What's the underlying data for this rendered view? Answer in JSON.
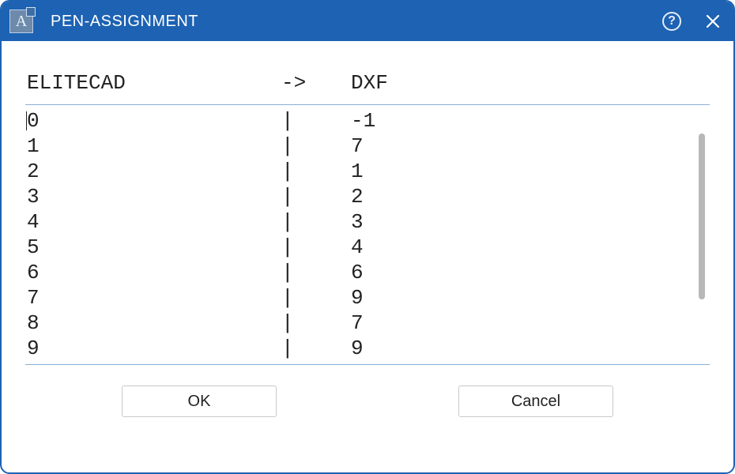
{
  "titlebar": {
    "app_icon_letter": "A",
    "title": "PEN-ASSIGNMENT",
    "help_label": "?",
    "close_label": "×"
  },
  "headers": {
    "left": "ELITECAD",
    "arrow": "->",
    "right": "DXF"
  },
  "separator": "|",
  "rows": [
    {
      "left": "0",
      "right": "-1"
    },
    {
      "left": "1",
      "right": "7"
    },
    {
      "left": "2",
      "right": "1"
    },
    {
      "left": "3",
      "right": "2"
    },
    {
      "left": "4",
      "right": "3"
    },
    {
      "left": "5",
      "right": "4"
    },
    {
      "left": "6",
      "right": "6"
    },
    {
      "left": "7",
      "right": "9"
    },
    {
      "left": "8",
      "right": "7"
    },
    {
      "left": "9",
      "right": "9"
    }
  ],
  "buttons": {
    "ok": "OK",
    "cancel": "Cancel"
  }
}
